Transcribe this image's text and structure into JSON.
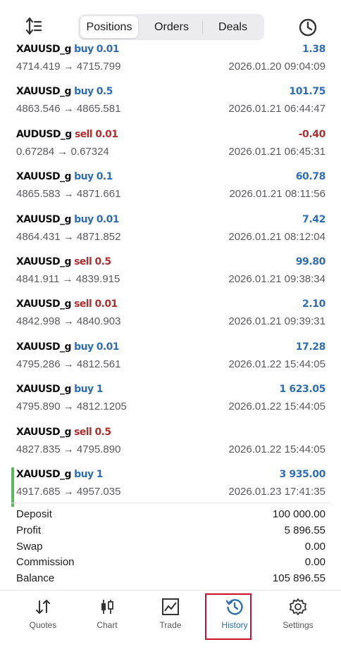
{
  "header": {
    "sort_icon": "sort-icon",
    "segments": [
      "Positions",
      "Orders",
      "Deals"
    ],
    "active_segment": 0,
    "history_icon": "clock-icon"
  },
  "deals": [
    {
      "symbol": "XAUUSD_g",
      "side": "buy",
      "volume": "0.01",
      "prices": "4714.419 → 4715.799",
      "time": "2026.01.20 09:04:09",
      "profit": "1.38"
    },
    {
      "symbol": "XAUUSD_g",
      "side": "buy",
      "volume": "0.5",
      "prices": "4863.546 → 4865.581",
      "time": "2026.01.21 06:44:47",
      "profit": "101.75"
    },
    {
      "symbol": "AUDUSD_g",
      "side": "sell",
      "volume": "0.01",
      "prices": "0.67284 → 0.67324",
      "time": "2026.01.21 06:45:31",
      "profit": "-0.40"
    },
    {
      "symbol": "XAUUSD_g",
      "side": "buy",
      "volume": "0.1",
      "prices": "4865.583 → 4871.661",
      "time": "2026.01.21 08:11:56",
      "profit": "60.78"
    },
    {
      "symbol": "XAUUSD_g",
      "side": "buy",
      "volume": "0.01",
      "prices": "4864.431 → 4871.852",
      "time": "2026.01.21 08:12:04",
      "profit": "7.42"
    },
    {
      "symbol": "XAUUSD_g",
      "side": "sell",
      "volume": "0.5",
      "prices": "4841.911 → 4839.915",
      "time": "2026.01.21 09:38:34",
      "profit": "99.80"
    },
    {
      "symbol": "XAUUSD_g",
      "side": "sell",
      "volume": "0.01",
      "prices": "4842.998 → 4840.903",
      "time": "2026.01.21 09:39:31",
      "profit": "2.10"
    },
    {
      "symbol": "XAUUSD_g",
      "side": "buy",
      "volume": "0.01",
      "prices": "4795.286 → 4812.561",
      "time": "2026.01.22 15:44:05",
      "profit": "17.28"
    },
    {
      "symbol": "XAUUSD_g",
      "side": "buy",
      "volume": "1",
      "prices": "4795.890 → 4812.1205",
      "time": "2026.01.22 15:44:05",
      "profit": "1 623.05"
    },
    {
      "symbol": "XAUUSD_g",
      "side": "sell",
      "volume": "0.5",
      "prices": "4827.835 → 4795.890",
      "time": "2026.01.22 15:44:05",
      "profit": ""
    },
    {
      "symbol": "XAUUSD_g",
      "side": "buy",
      "volume": "1",
      "prices": "4917.685 → 4957.035",
      "time": "2026.01.23 17:41:35",
      "profit": "3 935.00",
      "selected": true
    }
  ],
  "summary": {
    "deposit_label": "Deposit",
    "deposit": "100 000.00",
    "profit_label": "Profit",
    "profit": "5 896.55",
    "swap_label": "Swap",
    "swap": "0.00",
    "commission_label": "Commission",
    "commission": "0.00",
    "balance_label": "Balance",
    "balance": "105 896.55"
  },
  "tabbar": {
    "items": [
      {
        "label": "Quotes",
        "icon": "quotes-icon"
      },
      {
        "label": "Chart",
        "icon": "candlestick-icon"
      },
      {
        "label": "Trade",
        "icon": "trend-chart-icon"
      },
      {
        "label": "History",
        "icon": "history-icon"
      },
      {
        "label": "Settings",
        "icon": "gear-icon"
      }
    ],
    "active": 3
  },
  "colors": {
    "buy": "#2e6eb5",
    "sell": "#b02f2f",
    "selected_marker": "#5cb85c",
    "highlight_box": "#c8102e"
  }
}
